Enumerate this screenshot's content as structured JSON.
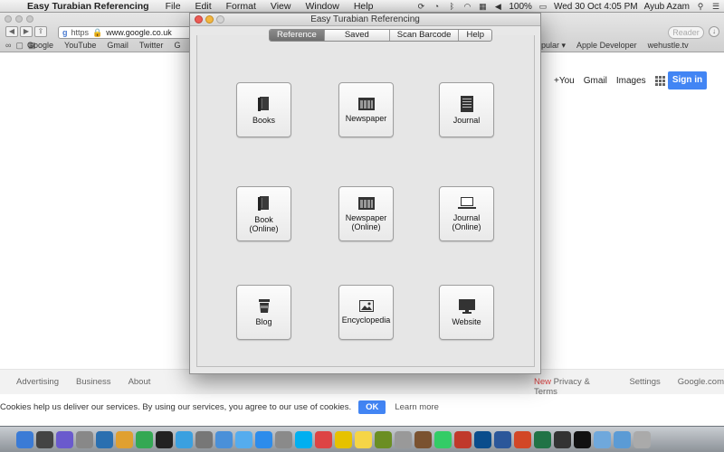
{
  "menubar": {
    "app_name": "Easy Turabian Referencing",
    "items": [
      "File",
      "Edit",
      "Format",
      "View",
      "Window",
      "Help"
    ],
    "battery": "100%",
    "datetime": "Wed 30 Oct  4:05 PM",
    "user": "Ayub Azam"
  },
  "browser": {
    "address_scheme": "https",
    "address": "www.google.co.uk",
    "reader_label": "Reader",
    "bookmarks_left": [
      "Google",
      "YouTube",
      "Gmail",
      "Twitter",
      "G"
    ],
    "bookmarks_right": [
      "opular ▾",
      "Apple Developer",
      "wehustle.tv"
    ]
  },
  "google": {
    "links": [
      "+You",
      "Gmail",
      "Images"
    ],
    "signin": "Sign in",
    "footer_left": [
      "Advertising",
      "Business",
      "About"
    ],
    "footer_new": "New",
    "footer_right": [
      "Privacy & Terms",
      "Settings",
      "Google.com"
    ],
    "cookie_text": "Cookies help us deliver our services. By using our services, you agree to our use of cookies.",
    "cookie_ok": "OK",
    "cookie_learn": "Learn more"
  },
  "window": {
    "title": "Easy Turabian Referencing",
    "tabs": [
      "Reference",
      "Saved",
      "Scan Barcode",
      "Help"
    ],
    "active_tab": "Reference"
  },
  "references": [
    {
      "label": "Books",
      "icon": "book-icon"
    },
    {
      "label": "Newspaper",
      "icon": "newspaper-icon"
    },
    {
      "label": "Journal",
      "icon": "journal-icon"
    },
    {
      "label": "Book\n(Online)",
      "icon": "book-icon"
    },
    {
      "label": "Newspaper\n(Online)",
      "icon": "newspaper-icon"
    },
    {
      "label": "Journal\n(Online)",
      "icon": "laptop-icon"
    },
    {
      "label": "Blog",
      "icon": "coffee-cup-icon"
    },
    {
      "label": "Encyclopedia",
      "icon": "picture-icon"
    },
    {
      "label": "Website",
      "icon": "monitor-icon"
    }
  ],
  "dock_icons": [
    "finder-icon",
    "dashboard-icon",
    "mission-control-icon",
    "launchpad-icon",
    "xcode-icon",
    "photos-icon",
    "chrome-icon",
    "terminal-icon",
    "itunes-icon",
    "calculator-icon",
    "safari-icon",
    "twitter-icon",
    "appstore-icon",
    "system-preferences-icon",
    "skype-icon",
    "calendar-icon",
    "notes-icon",
    "stickies-icon",
    "preview-icon",
    "network-icon",
    "dictionary-icon",
    "time-machine-icon",
    "pm-icon",
    "photoshop-icon",
    "word-icon",
    "powerpoint-icon",
    "excel-icon",
    "games-icon",
    "easy-turabian-icon",
    "folder-icon",
    "downloads-icon",
    "trash-icon"
  ]
}
